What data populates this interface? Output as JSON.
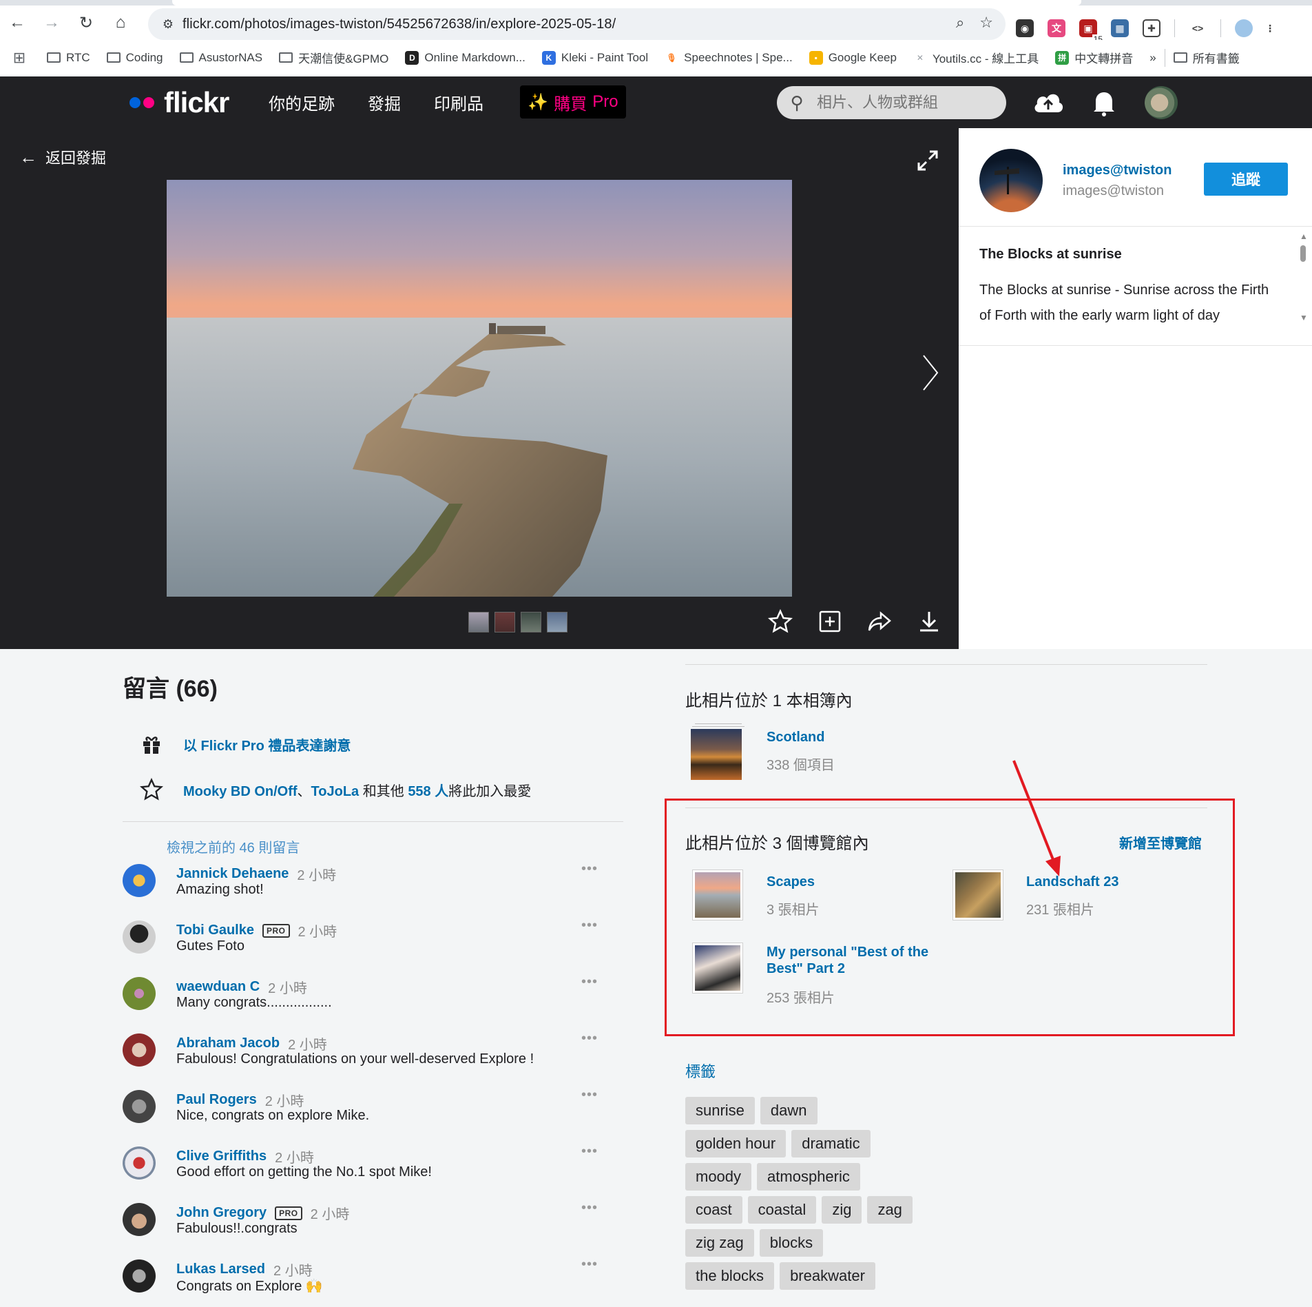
{
  "browser": {
    "url": "flickr.com/photos/images-twiston/54525672638/in/explore-2025-05-18/",
    "extension_badge": "15",
    "bookmarks": [
      {
        "label": "RTC",
        "type": "folder"
      },
      {
        "label": "Coding",
        "type": "folder"
      },
      {
        "label": "AsustorNAS",
        "type": "folder"
      },
      {
        "label": "天潮信使&GPMO",
        "type": "folder"
      },
      {
        "label": "Online Markdown...",
        "type": "site",
        "icon": "D",
        "color": "#222222"
      },
      {
        "label": "Kleki - Paint Tool",
        "type": "site",
        "icon": "K",
        "color": "#2f6fe0"
      },
      {
        "label": "Speechnotes | Spe...",
        "type": "site",
        "icon": "🎙",
        "color": "#ff7a1a"
      },
      {
        "label": "Google Keep",
        "type": "site",
        "icon": "▪",
        "color": "#f6b400"
      },
      {
        "label": "Youtils.cc - 線上工具",
        "type": "site",
        "icon": "✕",
        "color": "#9aa0a6"
      },
      {
        "label": "中文轉拼音",
        "type": "site",
        "icon": "拼",
        "color": "#2f9e44"
      }
    ],
    "bookmarks_overflow": "»",
    "all_bookmarks": "所有書籤"
  },
  "header": {
    "logo": "flickr",
    "nav": [
      "你的足跡",
      "發掘",
      "印刷品"
    ],
    "buy_pro_buy": "購買",
    "buy_pro_pro": "Pro",
    "search_placeholder": "相片、人物或群組"
  },
  "stage": {
    "back_label": "返回發掘"
  },
  "owner": {
    "name": "images@twiston",
    "handle": "images@twiston",
    "follow_label": "追蹤",
    "photo_title": "The Blocks at sunrise",
    "description": "The Blocks at sunrise - Sunrise across the Firth of Forth with the early warm light of day"
  },
  "comments": {
    "title": "留言 (66)",
    "thanks_link": "以 Flickr Pro 禮品表達謝意",
    "fav_user1": "Mooky BD On/Off",
    "fav_sep": "、",
    "fav_user2": "ToJoLa",
    "fav_mid": " 和其他 ",
    "fav_count": "558 人",
    "fav_end": "將此加入最愛",
    "prev_link": "檢視之前的 46 則留言",
    "more": "•••",
    "pro": "PRO",
    "items": [
      {
        "name": "Jannick Dehaene",
        "time": "2 小時",
        "text": "Amazing shot!",
        "pro": false,
        "avatar": "#2a6fd6"
      },
      {
        "name": "Tobi Gaulke",
        "time": "2 小時",
        "text": "Gutes Foto",
        "pro": true,
        "avatar": "#3b3b3b"
      },
      {
        "name": "waewduan C",
        "time": "2 小時",
        "text": "Many congrats.................",
        "pro": false,
        "avatar": "#7a8a3a"
      },
      {
        "name": "Abraham Jacob",
        "time": "2 小時",
        "text": "Fabulous! Congratulations on your well-deserved Explore !",
        "pro": false,
        "avatar": "#8b3a3a"
      },
      {
        "name": "Paul Rogers",
        "time": "2 小時",
        "text": "Nice, congrats on explore Mike.",
        "pro": false,
        "avatar": "#555555"
      },
      {
        "name": "Clive Griffiths",
        "time": "2 小時",
        "text": "Good effort on getting the No.1 spot Mike!",
        "pro": false,
        "avatar": "#b03030"
      },
      {
        "name": "John Gregory",
        "time": "2 小時",
        "text": "Fabulous!!.congrats",
        "pro": true,
        "avatar": "#4a4a4a"
      },
      {
        "name": "Lukas Larsed",
        "time": "2 小時",
        "text": "Congrats on Explore 🙌",
        "pro": false,
        "avatar": "#2f2f2f"
      }
    ]
  },
  "albums": {
    "heading": "此相片位於 1 本相簿內",
    "items": [
      {
        "name": "Scotland",
        "count": "338 個項目"
      }
    ]
  },
  "galleries": {
    "heading": "此相片位於 3 個博覽館內",
    "add_label": "新增至博覽館",
    "items": [
      {
        "name": "Scapes",
        "count": "3 張相片"
      },
      {
        "name": "Landschaft 23",
        "count": "231 張相片"
      },
      {
        "name_line1": "My personal \"Best of the",
        "name_line2": "Best\" Part 2",
        "count": "253 張相片"
      }
    ]
  },
  "tags": {
    "heading": "標籤",
    "items": [
      "sunrise",
      "dawn",
      "golden hour",
      "dramatic",
      "moody",
      "atmospheric",
      "coast",
      "coastal",
      "zig",
      "zag",
      "zig zag",
      "blocks",
      "the blocks",
      "breakwater"
    ]
  },
  "colors": {
    "link": "#006dac",
    "accent_blue": "#128fdc",
    "annotation_red": "#e21a22"
  }
}
